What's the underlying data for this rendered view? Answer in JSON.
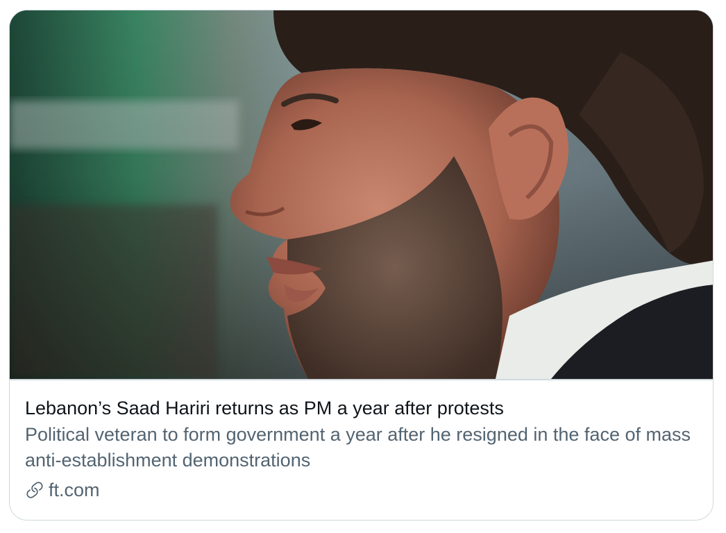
{
  "card": {
    "headline": "Lebanon’s Saad Hariri returns as PM a year after protests",
    "description": "Political veteran to form government a year after he resigned in the face of mass anti-establishment demonstrations",
    "domain": "ft.com",
    "domain_icon": "link-icon"
  },
  "colors": {
    "border": "#cfd9de",
    "headline": "#0f1419",
    "secondary": "#536471"
  }
}
